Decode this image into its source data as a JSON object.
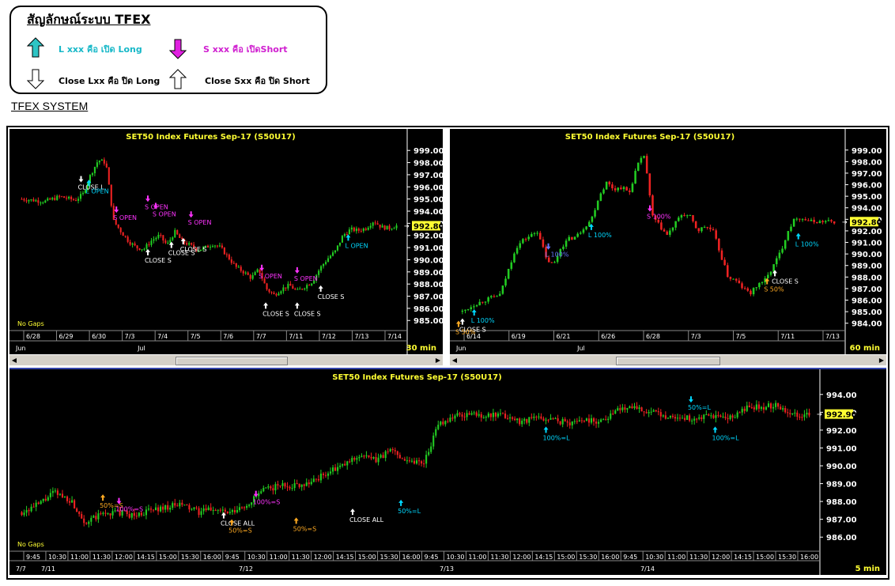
{
  "legend": {
    "title": "สัญลักษณ์ระบบ TFEX",
    "items": [
      {
        "label": "L xxx คือ เปิด Long",
        "color": "#17b8c8",
        "icon": "up-arrow-cyan"
      },
      {
        "label": "S xxx คือ เปิดShort",
        "color": "#d020d0",
        "icon": "down-arrow-magenta"
      },
      {
        "label": "Close Lxx คือ ปิด Long",
        "color": "#000000",
        "icon": "down-arrow-white"
      },
      {
        "label": "Close Sxx คือ ปิด Short",
        "color": "#000000",
        "icon": "up-arrow-white"
      }
    ]
  },
  "system_title": "TFEX SYSTEM",
  "colors": {
    "up": "#22cc22",
    "down": "#ee2222",
    "bg": "#000000",
    "grid": "#555555",
    "white": "#ffffff",
    "cyan": "#00d8ff",
    "magenta": "#ff33ff",
    "orange": "#ffaa22",
    "yellow": "#ffff33",
    "blue": "#6677ff"
  },
  "chart_data": [
    {
      "type": "candlestick",
      "title": "SET50 Index Futures Sep-17 (S50U17)",
      "timeframe": "30 min",
      "ylim": [
        984.3,
        999.6
      ],
      "yticks": [
        "999.00",
        "998.00",
        "997.00",
        "996.00",
        "995.00",
        "994.00",
        "993.00",
        "992.00",
        "991.00",
        "990.00",
        "989.00",
        "988.00",
        "987.00",
        "986.00",
        "985.00"
      ],
      "yvalues": [
        999,
        998,
        997,
        996,
        995,
        994,
        993,
        992,
        991,
        990,
        989,
        988,
        987,
        986,
        985
      ],
      "last_price": "992.80",
      "last_value": 992.8,
      "x_labels": [
        "6/28",
        "6/29",
        "6/30",
        "7/3",
        "7/4",
        "7/5",
        "7/6",
        "7/7",
        "7/11",
        "7/12",
        "7/13",
        "7/14"
      ],
      "month_labels": [
        "Jun",
        "Jul"
      ],
      "no_gaps": "No Gaps",
      "path": [
        [
          0,
          995.0
        ],
        [
          6,
          994.8
        ],
        [
          10,
          995.2
        ],
        [
          14,
          994.9
        ],
        [
          16,
          995.4
        ],
        [
          18,
          997.0
        ],
        [
          20,
          998.2
        ],
        [
          22,
          998.0
        ],
        [
          24,
          993.2
        ],
        [
          26,
          992.3
        ],
        [
          28,
          991.5
        ],
        [
          30,
          991.0
        ],
        [
          32,
          990.9
        ],
        [
          34,
          991.6
        ],
        [
          36,
          992.0
        ],
        [
          38,
          991.2
        ],
        [
          40,
          992.3
        ],
        [
          42,
          991.5
        ],
        [
          44,
          991.2
        ],
        [
          46,
          990.8
        ],
        [
          48,
          991.0
        ],
        [
          50,
          991.3
        ],
        [
          52,
          991.0
        ],
        [
          54,
          990.2
        ],
        [
          56,
          989.4
        ],
        [
          58,
          989.0
        ],
        [
          60,
          988.5
        ],
        [
          62,
          989.2
        ],
        [
          64,
          987.6
        ],
        [
          66,
          987.1
        ],
        [
          68,
          987.6
        ],
        [
          70,
          987.9
        ],
        [
          72,
          987.4
        ],
        [
          74,
          987.8
        ],
        [
          76,
          988.2
        ],
        [
          78,
          989.3
        ],
        [
          80,
          990.1
        ],
        [
          82,
          990.7
        ],
        [
          84,
          992.0
        ],
        [
          86,
          992.5
        ],
        [
          88,
          992.4
        ],
        [
          90,
          992.6
        ],
        [
          92,
          993.2
        ],
        [
          94,
          992.7
        ],
        [
          96,
          992.6
        ],
        [
          98,
          992.8
        ]
      ],
      "annotations": [
        {
          "text": "CLOSE L",
          "x": 17,
          "y": 996.3,
          "color": "white",
          "arrow": "down"
        },
        {
          "text": "L OPEN",
          "x": 19,
          "y": 996.0,
          "color": "cyan",
          "arrow": "up"
        },
        {
          "text": "S OPEN",
          "x": 26,
          "y": 993.8,
          "color": "magenta",
          "arrow": "down"
        },
        {
          "text": "S OPEN",
          "x": 34,
          "y": 994.7,
          "color": "magenta",
          "arrow": "down"
        },
        {
          "text": "S OPEN",
          "x": 36,
          "y": 994.1,
          "color": "magenta",
          "arrow": "down"
        },
        {
          "text": "S OPEN",
          "x": 45,
          "y": 993.4,
          "color": "magenta",
          "arrow": "down"
        },
        {
          "text": "CLOSE S",
          "x": 34,
          "y": 990.3,
          "color": "white",
          "arrow": "up"
        },
        {
          "text": "CLOSE S",
          "x": 40,
          "y": 990.9,
          "color": "white",
          "arrow": "up"
        },
        {
          "text": "CLOSE S",
          "x": 43,
          "y": 991.2,
          "color": "white",
          "arrow": "up"
        },
        {
          "text": "S OPEN",
          "x": 63,
          "y": 989.0,
          "color": "magenta",
          "arrow": "down"
        },
        {
          "text": "S OPEN",
          "x": 72,
          "y": 988.8,
          "color": "magenta",
          "arrow": "down"
        },
        {
          "text": "CLOSE S",
          "x": 64,
          "y": 985.9,
          "color": "white",
          "arrow": "up"
        },
        {
          "text": "CLOSE S",
          "x": 72,
          "y": 985.9,
          "color": "white",
          "arrow": "up"
        },
        {
          "text": "CLOSE S",
          "x": 78,
          "y": 987.3,
          "color": "white",
          "arrow": "up"
        },
        {
          "text": "L OPEN",
          "x": 85,
          "y": 991.5,
          "color": "cyan",
          "arrow": "up"
        }
      ]
    },
    {
      "type": "candlestick",
      "title": "SET50 Index Futures Sep-17 (S50U17)",
      "timeframe": "60 min",
      "ylim": [
        983.5,
        999.6
      ],
      "yticks": [
        "999.00",
        "998.00",
        "997.00",
        "996.00",
        "995.00",
        "994.00",
        "993.00",
        "992.00",
        "991.00",
        "990.00",
        "989.00",
        "988.00",
        "987.00",
        "986.00",
        "985.00",
        "984.00"
      ],
      "yvalues": [
        999,
        998,
        997,
        996,
        995,
        994,
        993,
        992,
        991,
        990,
        989,
        988,
        987,
        986,
        985,
        984
      ],
      "last_price": "992.80",
      "last_value": 992.8,
      "x_labels": [
        "6/14",
        "6/19",
        "6/21",
        "6/26",
        "6/28",
        "7/3",
        "7/5",
        "7/11",
        "7/13"
      ],
      "month_labels": [
        "Jun",
        "Jul"
      ],
      "no_gaps": "",
      "path": [
        [
          0,
          985.0
        ],
        [
          3,
          985.6
        ],
        [
          6,
          986.0
        ],
        [
          10,
          986.5
        ],
        [
          12,
          988.5
        ],
        [
          14,
          990.5
        ],
        [
          16,
          991.2
        ],
        [
          18,
          991.6
        ],
        [
          20,
          992.0
        ],
        [
          22,
          989.6
        ],
        [
          24,
          989.0
        ],
        [
          26,
          990.6
        ],
        [
          28,
          991.3
        ],
        [
          30,
          991.5
        ],
        [
          32,
          992.3
        ],
        [
          34,
          993.0
        ],
        [
          36,
          995.0
        ],
        [
          38,
          996.2
        ],
        [
          40,
          995.6
        ],
        [
          42,
          995.8
        ],
        [
          44,
          995.3
        ],
        [
          46,
          997.6
        ],
        [
          48,
          998.6
        ],
        [
          50,
          993.3
        ],
        [
          52,
          992.4
        ],
        [
          54,
          991.6
        ],
        [
          56,
          992.6
        ],
        [
          58,
          993.5
        ],
        [
          60,
          993.2
        ],
        [
          62,
          992.0
        ],
        [
          64,
          992.4
        ],
        [
          66,
          992.0
        ],
        [
          68,
          990.0
        ],
        [
          70,
          988.0
        ],
        [
          72,
          987.7
        ],
        [
          74,
          987.0
        ],
        [
          76,
          986.6
        ],
        [
          78,
          987.4
        ],
        [
          80,
          987.8
        ],
        [
          82,
          989.0
        ],
        [
          84,
          990.3
        ],
        [
          86,
          992.2
        ],
        [
          88,
          993.2
        ],
        [
          90,
          993.0
        ],
        [
          92,
          992.8
        ],
        [
          98,
          992.8
        ]
      ],
      "annotations": [
        {
          "text": "CLOSE S",
          "x": 2,
          "y": 983.8,
          "color": "white",
          "arrow": "up"
        },
        {
          "text": "S 50%",
          "x": 1,
          "y": 983.6,
          "color": "orange",
          "arrow": "up"
        },
        {
          "text": "L 100%",
          "x": 5,
          "y": 984.6,
          "color": "cyan",
          "arrow": "up"
        },
        {
          "text": "L 100%",
          "x": 24,
          "y": 990.3,
          "color": "blue",
          "arrow": "down"
        },
        {
          "text": "L 100%",
          "x": 35,
          "y": 992.0,
          "color": "cyan",
          "arrow": "up"
        },
        {
          "text": "S 100%",
          "x": 50,
          "y": 993.6,
          "color": "magenta",
          "arrow": "down"
        },
        {
          "text": "CLOSE S",
          "x": 82,
          "y": 988.0,
          "color": "white",
          "arrow": "up"
        },
        {
          "text": "S 50%",
          "x": 80,
          "y": 987.3,
          "color": "orange",
          "arrow": "up"
        },
        {
          "text": "L 100%",
          "x": 88,
          "y": 991.2,
          "color": "cyan",
          "arrow": "up"
        }
      ]
    },
    {
      "type": "candlestick",
      "title": "SET50 Index Futures Sep-17 (S50U17)",
      "timeframe": "5 min",
      "ylim": [
        985.3,
        994.7
      ],
      "yticks": [
        "994.00",
        "993.00",
        "992.00",
        "991.00",
        "990.00",
        "989.00",
        "988.00",
        "987.00",
        "986.00"
      ],
      "yvalues": [
        994,
        993,
        992,
        991,
        990,
        989,
        988,
        987,
        986
      ],
      "last_price": "992.90",
      "last_value": 992.9,
      "x_labels": [
        "9:45",
        "10:30",
        "11:00",
        "11:30",
        "12:00",
        "14:15",
        "15:00",
        "15:30",
        "16:00",
        "9:45",
        "10:30",
        "11:00",
        "11:30",
        "12:00",
        "14:15",
        "15:00",
        "15:30",
        "16:00",
        "9:45",
        "10:30",
        "11:00",
        "11:30",
        "12:00",
        "14:15",
        "15:00",
        "15:30",
        "16:00",
        "9:45",
        "10:30",
        "11:00",
        "11:30",
        "12:00",
        "14:15",
        "15:00",
        "15:30",
        "16:00"
      ],
      "month_labels": [
        "7/7",
        "7/11",
        "7/12",
        "7/13",
        "7/14"
      ],
      "no_gaps": "No Gaps",
      "path": [
        [
          0,
          987.4
        ],
        [
          2,
          987.8
        ],
        [
          4,
          988.5
        ],
        [
          6,
          988.1
        ],
        [
          8,
          986.8
        ],
        [
          10,
          987.3
        ],
        [
          12,
          987.4
        ],
        [
          14,
          987.2
        ],
        [
          16,
          987.5
        ],
        [
          18,
          987.7
        ],
        [
          20,
          987.8
        ],
        [
          22,
          987.4
        ],
        [
          24,
          987.6
        ],
        [
          26,
          987.3
        ],
        [
          28,
          987.8
        ],
        [
          30,
          988.6
        ],
        [
          32,
          988.9
        ],
        [
          34,
          988.9
        ],
        [
          36,
          989.1
        ],
        [
          38,
          989.6
        ],
        [
          40,
          990.0
        ],
        [
          42,
          990.6
        ],
        [
          44,
          990.3
        ],
        [
          46,
          990.9
        ],
        [
          48,
          990.3
        ],
        [
          50,
          990.2
        ],
        [
          52,
          992.4
        ],
        [
          54,
          992.8
        ],
        [
          56,
          992.9
        ],
        [
          58,
          992.8
        ],
        [
          60,
          992.8
        ],
        [
          62,
          992.5
        ],
        [
          64,
          992.7
        ],
        [
          66,
          992.6
        ],
        [
          68,
          992.4
        ],
        [
          70,
          992.6
        ],
        [
          72,
          992.5
        ],
        [
          74,
          993.1
        ],
        [
          76,
          993.4
        ],
        [
          78,
          993.0
        ],
        [
          80,
          992.8
        ],
        [
          82,
          992.7
        ],
        [
          84,
          992.6
        ],
        [
          86,
          992.8
        ],
        [
          88,
          992.6
        ],
        [
          90,
          993.2
        ],
        [
          92,
          993.3
        ],
        [
          94,
          993.4
        ],
        [
          96,
          992.9
        ],
        [
          98,
          992.9
        ]
      ],
      "annotations": [
        {
          "text": "50%=S",
          "x": 11,
          "y": 988.0,
          "color": "orange",
          "arrow": "up"
        },
        {
          "text": "100%=S",
          "x": 13,
          "y": 987.8,
          "color": "magenta",
          "arrow": "down"
        },
        {
          "text": "CLOSE ALL",
          "x": 26,
          "y": 987.0,
          "color": "white",
          "arrow": "up"
        },
        {
          "text": "50%=S",
          "x": 27,
          "y": 986.6,
          "color": "orange",
          "arrow": "up"
        },
        {
          "text": "100%=S",
          "x": 30,
          "y": 988.2,
          "color": "magenta",
          "arrow": "down"
        },
        {
          "text": "50%=S",
          "x": 35,
          "y": 986.7,
          "color": "orange",
          "arrow": "up"
        },
        {
          "text": "CLOSE ALL",
          "x": 42,
          "y": 987.2,
          "color": "white",
          "arrow": "up"
        },
        {
          "text": "50%=L",
          "x": 48,
          "y": 987.7,
          "color": "cyan",
          "arrow": "up"
        },
        {
          "text": "100%=L",
          "x": 66,
          "y": 991.8,
          "color": "cyan",
          "arrow": "up"
        },
        {
          "text": "50%=L",
          "x": 84,
          "y": 993.5,
          "color": "cyan",
          "arrow": "down"
        },
        {
          "text": "100%=L",
          "x": 87,
          "y": 991.8,
          "color": "cyan",
          "arrow": "up"
        }
      ]
    }
  ]
}
